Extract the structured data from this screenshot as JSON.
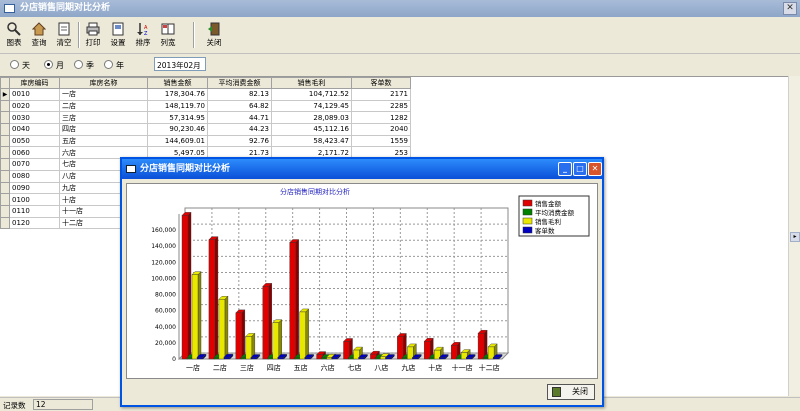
{
  "window": {
    "title": "分店销售同期对比分析"
  },
  "toolbar": {
    "chart": "图表",
    "query": "查询",
    "clear": "清空",
    "print": "打印",
    "settings": "设置",
    "sort": "排序",
    "column_width": "列宽",
    "close": "关闭"
  },
  "filter": {
    "day": "天",
    "month": "月",
    "season": "季",
    "year": "年",
    "selected": "月",
    "date_value": "2013年02月"
  },
  "table": {
    "columns": [
      "库房编码",
      "库房名称",
      "销售金额",
      "平均消费金额",
      "销售毛利",
      "客单数"
    ],
    "rows": [
      [
        "0010",
        "一店",
        "178,304.76",
        "82.13",
        "104,712.52",
        "2171"
      ],
      [
        "0020",
        "二店",
        "148,119.70",
        "64.82",
        "74,129.45",
        "2285"
      ],
      [
        "0030",
        "三店",
        "57,314.95",
        "44.71",
        "28,089.03",
        "1282"
      ],
      [
        "0040",
        "四店",
        "90,230.46",
        "44.23",
        "45,112.16",
        "2040"
      ],
      [
        "0050",
        "五店",
        "144,609.01",
        "92.76",
        "58,423.47",
        "1559"
      ],
      [
        "0060",
        "六店",
        "5,497.05",
        "21.73",
        "2,171.72",
        "253"
      ],
      [
        "0070",
        "七店",
        "21,785.30",
        "40.57",
        "11,113.37",
        "537"
      ],
      [
        "0080",
        "八店",
        "",
        "",
        "",
        ""
      ],
      [
        "0090",
        "九店",
        "",
        "",
        "",
        ""
      ],
      [
        "0100",
        "十店",
        "",
        "",
        "",
        ""
      ],
      [
        "0110",
        "十一店",
        "",
        "",
        "",
        ""
      ],
      [
        "0120",
        "十二店",
        "",
        "",
        "",
        ""
      ]
    ]
  },
  "status": {
    "record_label": "记录数",
    "record_count": "12"
  },
  "popup": {
    "title": "分店销售同期对比分析",
    "close_label": "关闭"
  },
  "chart_data": {
    "type": "bar",
    "title": "分店销售同期对比分析",
    "categories": [
      "一店",
      "二店",
      "三店",
      "四店",
      "五店",
      "六店",
      "七店",
      "八店",
      "九店",
      "十店",
      "十一店",
      "十二店"
    ],
    "series": [
      {
        "name": "销售金额",
        "color": "#E00000",
        "values": [
          178305,
          148120,
          57315,
          90230,
          144609,
          5497,
          21785,
          6000,
          28000,
          22000,
          17000,
          32000
        ]
      },
      {
        "name": "平均消费金额",
        "color": "#008000",
        "values": [
          82,
          65,
          45,
          44,
          93,
          22,
          41,
          30,
          40,
          35,
          30,
          38
        ]
      },
      {
        "name": "销售毛利",
        "color": "#E8E800",
        "values": [
          104713,
          74129,
          28089,
          45112,
          58423,
          2172,
          11113,
          3000,
          15000,
          11000,
          8000,
          15000
        ]
      },
      {
        "name": "客单数",
        "color": "#0000C0",
        "values": [
          2171,
          2285,
          1282,
          2040,
          1559,
          253,
          537,
          200,
          800,
          700,
          600,
          900
        ]
      }
    ],
    "yticks": [
      "0",
      "20,000",
      "40,000",
      "60,000",
      "80,000",
      "100,000",
      "120,000",
      "140,000",
      "160,000"
    ],
    "ylim": [
      0,
      180000
    ],
    "grid": true,
    "legend": "top-right"
  }
}
